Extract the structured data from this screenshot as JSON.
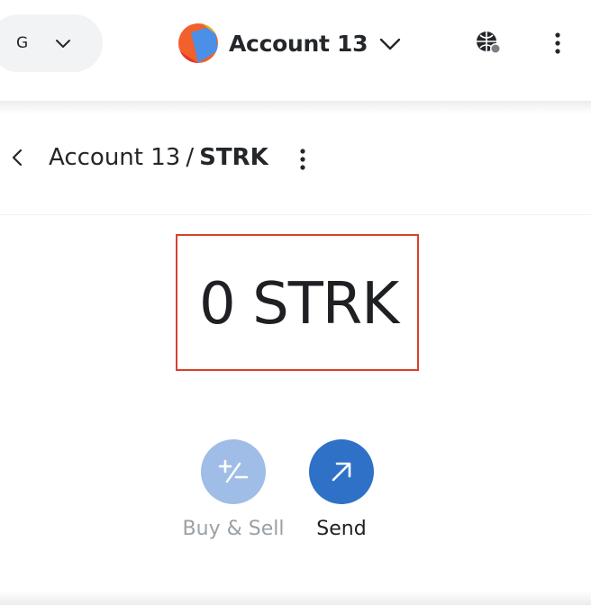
{
  "header": {
    "network_letter": "G",
    "account_name": "Account 13",
    "icons": {
      "network_chevron": "chevron-down-icon",
      "account_chevron": "chevron-down-icon",
      "globe": "globe-icon",
      "menu": "kebab-menu-icon"
    }
  },
  "breadcrumb": {
    "account": "Account 13",
    "separator": "/",
    "token": "STRK",
    "icons": {
      "back": "chevron-left-icon",
      "menu": "kebab-menu-icon"
    }
  },
  "balance": {
    "amount_text": "0 STRK",
    "highlight_color": "#d7412f"
  },
  "actions": [
    {
      "label": "Buy & Sell",
      "icon": "plus-minus-icon",
      "enabled": false,
      "color": "#9fbde6"
    },
    {
      "label": "Send",
      "icon": "arrow-up-right-icon",
      "enabled": true,
      "color": "#2f71c6"
    }
  ]
}
